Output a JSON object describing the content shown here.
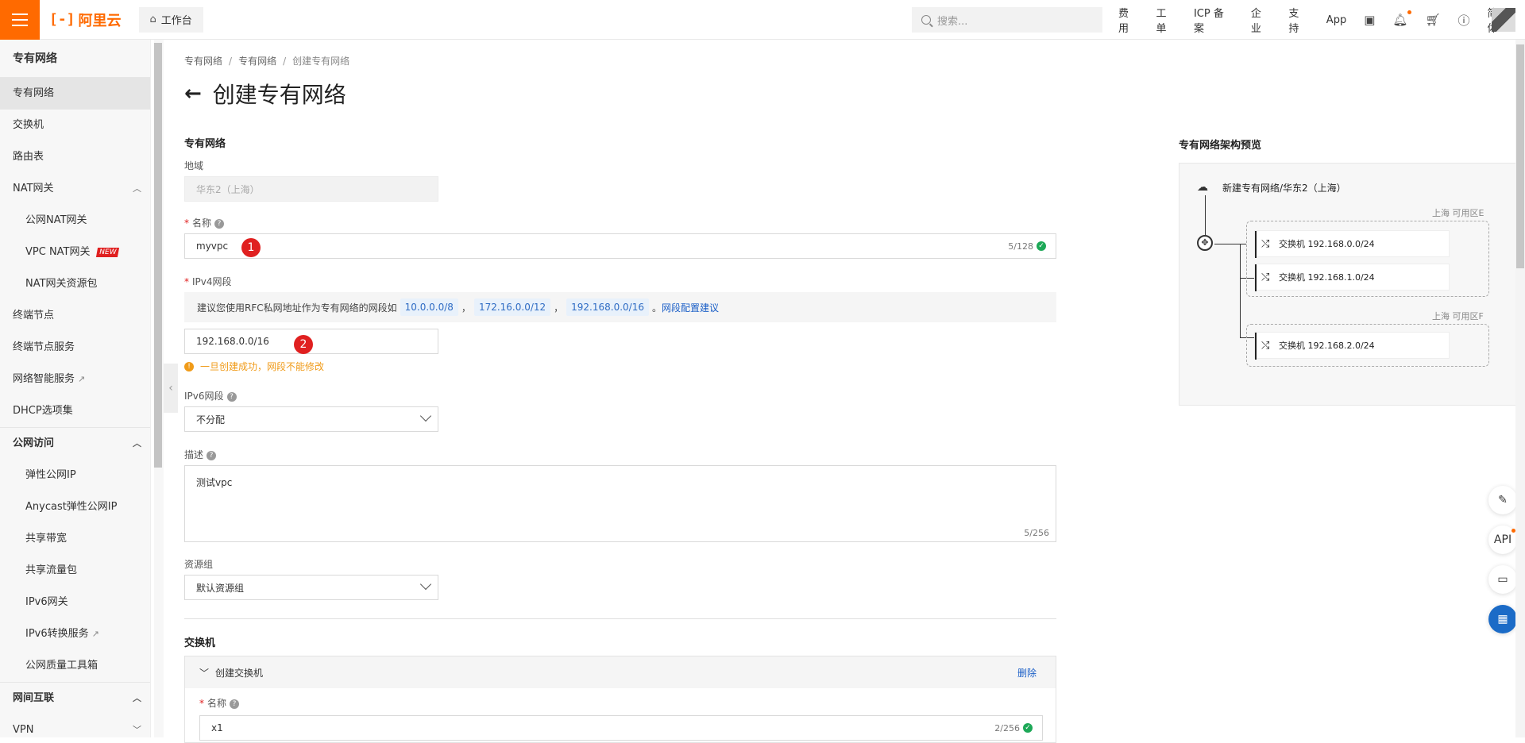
{
  "topbar": {
    "logo_text": "阿里云",
    "workbench": "工作台",
    "search_placeholder": "搜索...",
    "nav": [
      "费用",
      "工单",
      "ICP 备案",
      "企业",
      "支持",
      "App"
    ],
    "lang": "简体"
  },
  "sidebar": {
    "title": "专有网络",
    "items": [
      {
        "label": "专有网络",
        "active": true
      },
      {
        "label": "交换机"
      },
      {
        "label": "路由表"
      },
      {
        "label": "NAT网关",
        "group_toggle": "up"
      },
      {
        "label": "公网NAT网关",
        "sub": true
      },
      {
        "label": "VPC NAT网关",
        "sub": true,
        "badge": "NEW"
      },
      {
        "label": "NAT网关资源包",
        "sub": true
      },
      {
        "label": "终端节点"
      },
      {
        "label": "终端节点服务"
      },
      {
        "label": "网络智能服务",
        "external": true
      },
      {
        "label": "DHCP选项集"
      }
    ],
    "group2": "公网访问",
    "items2": [
      {
        "label": "弹性公网IP"
      },
      {
        "label": "Anycast弹性公网IP"
      },
      {
        "label": "共享带宽"
      },
      {
        "label": "共享流量包"
      },
      {
        "label": "IPv6网关"
      },
      {
        "label": "IPv6转换服务",
        "external": true
      },
      {
        "label": "公网质量工具箱"
      }
    ],
    "group3": "网间互联",
    "item_partial": "VPN"
  },
  "breadcrumb": [
    "专有网络",
    "专有网络",
    "创建专有网络"
  ],
  "page_title": "创建专有网络",
  "form": {
    "section_vpc": "专有网络",
    "region_label": "地域",
    "region_value": "华东2（上海）",
    "name_label": "名称",
    "name_value": "myvpc",
    "name_count": "5/128",
    "step1": "1",
    "ipv4_label": "IPv4网段",
    "ipv4_hint_prefix": "建议您使用RFC私网地址作为专有网络的网段如",
    "ipv4_tags": [
      "10.0.0.0/8",
      "172.16.0.0/12",
      "192.168.0.0/16"
    ],
    "ipv4_hint_sep": "，",
    "ipv4_hint_end": "。",
    "ipv4_link": "网段配置建议",
    "ipv4_value": "192.168.0.0/16",
    "step2": "2",
    "ipv4_warn": "一旦创建成功，网段不能修改",
    "ipv6_label": "IPv6网段",
    "ipv6_value": "不分配",
    "desc_label": "描述",
    "desc_value": "测试vpc",
    "desc_count": "5/256",
    "rg_label": "资源组",
    "rg_value": "默认资源组",
    "section_switch": "交换机",
    "switch_panel_title": "创建交换机",
    "switch_delete": "删除",
    "switch_name_label": "名称",
    "switch_name_value": "x1",
    "switch_name_count": "2/256"
  },
  "preview": {
    "title": "专有网络架构预览",
    "vpc_label": "新建专有网络/华东2（上海）",
    "zone1": "上海 可用区E",
    "zone2": "上海 可用区F",
    "switches": [
      "交换机 192.168.0.0/24",
      "交换机 192.168.1.0/24",
      "交换机 192.168.2.0/24"
    ]
  },
  "floating": {
    "api": "API"
  },
  "icons": [
    "menu-icon",
    "home-icon",
    "search-icon",
    "terminal-icon",
    "bell-icon",
    "cart-icon",
    "help-icon",
    "cloud-icon",
    "router-icon",
    "switch-icon",
    "feedback-icon",
    "chat-icon",
    "apps-icon"
  ],
  "colors": {
    "accent": "#ff6a00",
    "link": "#1b5fc7",
    "step": "#e02020",
    "warn": "#f09b19"
  }
}
